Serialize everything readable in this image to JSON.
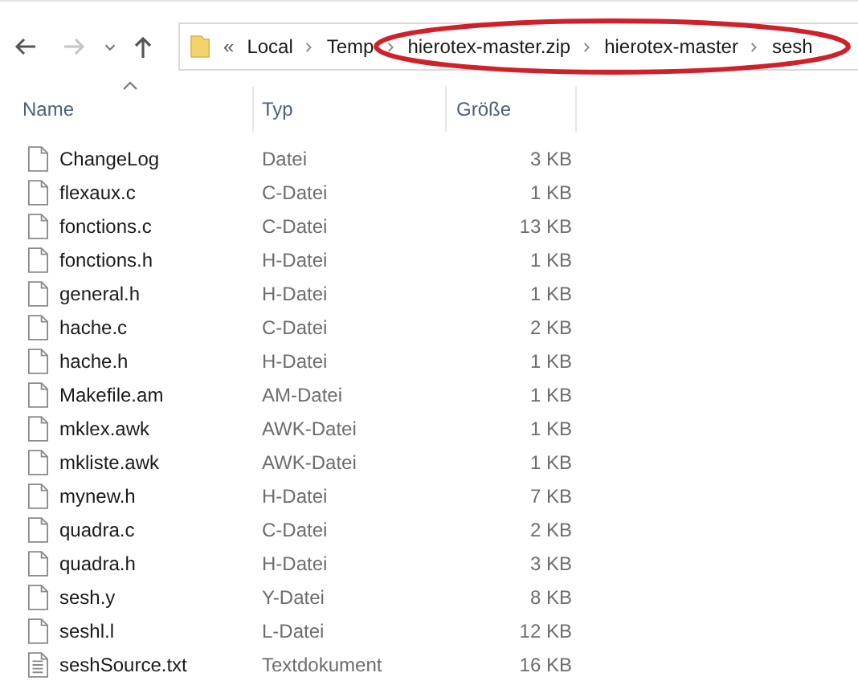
{
  "breadcrumb": {
    "overflow": "«",
    "segments": [
      "Local",
      "Temp",
      "hierotex-master.zip",
      "hierotex-master",
      "sesh"
    ]
  },
  "columns": [
    {
      "label": "Name",
      "sorted": true
    },
    {
      "label": "Typ",
      "sorted": false
    },
    {
      "label": "Größe",
      "sorted": false
    }
  ],
  "files": [
    {
      "name": "ChangeLog",
      "type": "Datei",
      "size": "3 KB",
      "kind": "file"
    },
    {
      "name": "flexaux.c",
      "type": "C-Datei",
      "size": "1 KB",
      "kind": "file"
    },
    {
      "name": "fonctions.c",
      "type": "C-Datei",
      "size": "13 KB",
      "kind": "file"
    },
    {
      "name": "fonctions.h",
      "type": "H-Datei",
      "size": "1 KB",
      "kind": "file"
    },
    {
      "name": "general.h",
      "type": "H-Datei",
      "size": "1 KB",
      "kind": "file"
    },
    {
      "name": "hache.c",
      "type": "C-Datei",
      "size": "2 KB",
      "kind": "file"
    },
    {
      "name": "hache.h",
      "type": "H-Datei",
      "size": "1 KB",
      "kind": "file"
    },
    {
      "name": "Makefile.am",
      "type": "AM-Datei",
      "size": "1 KB",
      "kind": "file"
    },
    {
      "name": "mklex.awk",
      "type": "AWK-Datei",
      "size": "1 KB",
      "kind": "file"
    },
    {
      "name": "mkliste.awk",
      "type": "AWK-Datei",
      "size": "1 KB",
      "kind": "file"
    },
    {
      "name": "mynew.h",
      "type": "H-Datei",
      "size": "7 KB",
      "kind": "file"
    },
    {
      "name": "quadra.c",
      "type": "C-Datei",
      "size": "2 KB",
      "kind": "file"
    },
    {
      "name": "quadra.h",
      "type": "H-Datei",
      "size": "3 KB",
      "kind": "file"
    },
    {
      "name": "sesh.y",
      "type": "Y-Datei",
      "size": "8 KB",
      "kind": "file"
    },
    {
      "name": "seshl.l",
      "type": "L-Datei",
      "size": "12 KB",
      "kind": "file"
    },
    {
      "name": "seshSource.txt",
      "type": "Textdokument",
      "size": "16 KB",
      "kind": "text"
    }
  ]
}
